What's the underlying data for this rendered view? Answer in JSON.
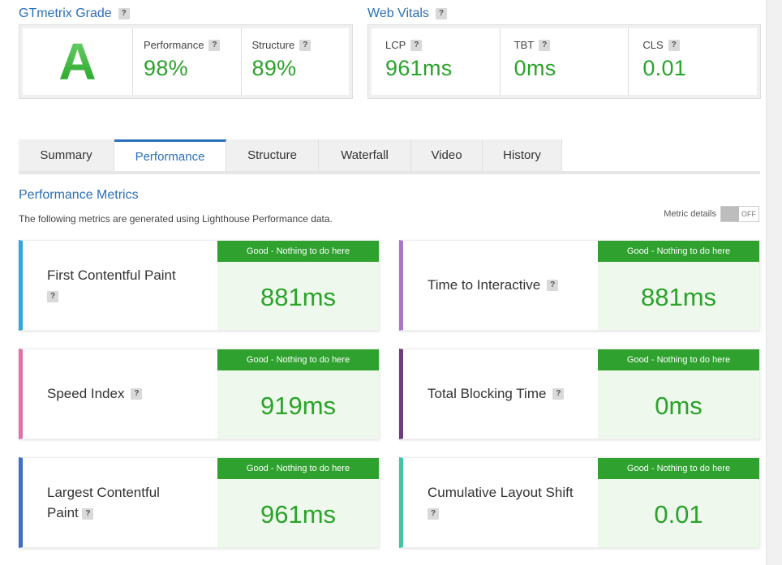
{
  "gtmetrix": {
    "title": "GTmetrix Grade",
    "grade": "A",
    "performance_label": "Performance",
    "performance_value": "98%",
    "structure_label": "Structure",
    "structure_value": "89%"
  },
  "web_vitals": {
    "title": "Web Vitals",
    "lcp_label": "LCP",
    "lcp_value": "961ms",
    "tbt_label": "TBT",
    "tbt_value": "0ms",
    "cls_label": "CLS",
    "cls_value": "0.01"
  },
  "help_glyph": "?",
  "tabs": [
    {
      "label": "Summary"
    },
    {
      "label": "Performance"
    },
    {
      "label": "Structure"
    },
    {
      "label": "Waterfall"
    },
    {
      "label": "Video"
    },
    {
      "label": "History"
    }
  ],
  "active_tab": "Performance",
  "performance_metrics": {
    "title": "Performance Metrics",
    "description": "The following metrics are generated using Lighthouse Performance data.",
    "metric_details_label": "Metric details",
    "toggle_state": "OFF"
  },
  "metrics": [
    {
      "label": "First Contentful Paint",
      "badge": "Good - Nothing to do here",
      "value": "881ms",
      "color": "#2fa7e0"
    },
    {
      "label": "Time to Interactive",
      "badge": "Good - Nothing to do here",
      "value": "881ms",
      "color": "#a879c8"
    },
    {
      "label": "Speed Index",
      "badge": "Good - Nothing to do here",
      "value": "919ms",
      "color": "#e86ea6"
    },
    {
      "label": "Total Blocking Time",
      "badge": "Good - Nothing to do here",
      "value": "0ms",
      "color": "#6b3f7b"
    },
    {
      "label": "Largest Contentful Paint",
      "badge": "Good - Nothing to do here",
      "value": "961ms",
      "color": "#3c6fcc"
    },
    {
      "label": "Cumulative Layout Shift",
      "badge": "Good - Nothing to do here",
      "value": "0.01",
      "color": "#44c4a3"
    }
  ],
  "colors": {
    "accent": "#2a6fb8",
    "good_green": "#2ea12e",
    "value_green": "#2aa32a"
  }
}
